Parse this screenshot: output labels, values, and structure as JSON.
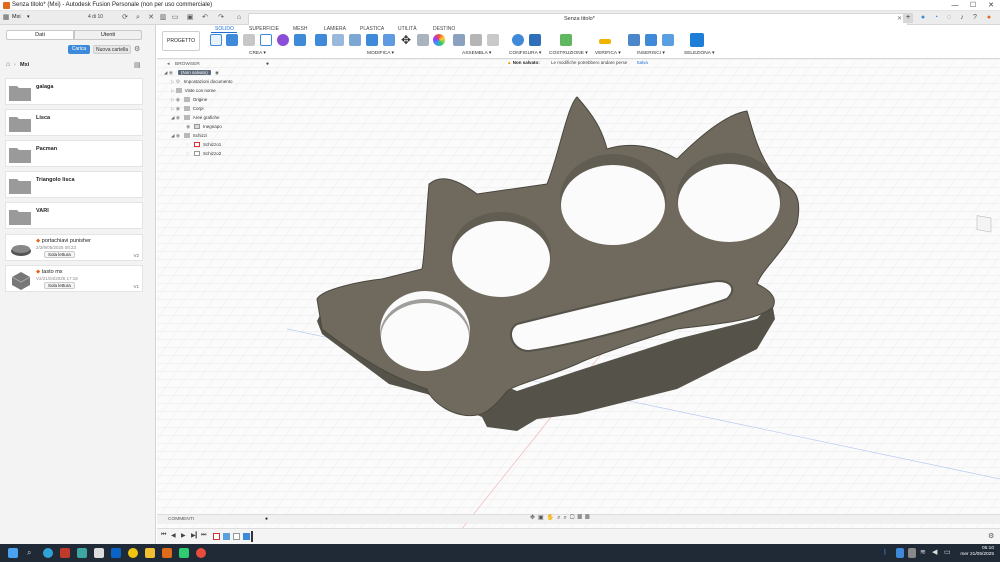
{
  "titlebar": {
    "title": "Senza titolo* (Mxi) - Autodesk Fusion Personale (non per uso commerciale)",
    "minimize": "—",
    "maximize": "☐",
    "close": "✕"
  },
  "appbar": {
    "user": "Mxi",
    "version_badge": "4 di 10",
    "doc_tab": "Senza titolo*"
  },
  "left_panel": {
    "tabs": [
      "Dati",
      "Utenti"
    ],
    "upload_label": "Carica",
    "new_folder_label": "Nuova cartella",
    "breadcrumb": "Mxi",
    "folders": [
      "galaga",
      "Lisca",
      "Pacman",
      "Triangolo lisca",
      "VARI"
    ],
    "designs": [
      {
        "name": "portachiavi punisher",
        "date": "2/3/9/05/2025 08:23",
        "badge": "Sola lettura",
        "version": "V2"
      },
      {
        "name": "tasto mx",
        "date": "V2/21/04/2025 17:18",
        "badge": "Sola lettura",
        "version": "V1"
      }
    ]
  },
  "toolbar": {
    "tabs": [
      "SOLIDO",
      "SUPERFICIE",
      "MESH",
      "LAMIERA",
      "PLASTICA",
      "UTILITÀ",
      "DESTINO"
    ],
    "active_tab": "SOLIDO",
    "project_label": "PROGETTO",
    "groups": [
      "CREA ▾",
      "MODIFICA ▾",
      "ASSEMBLA ▾",
      "CONFIGURA ▾",
      "COSTRUZIONE ▾",
      "VERIFICA ▾",
      "INSERISCI ▾",
      "SELEZIONA ▾"
    ]
  },
  "browser": {
    "title": "BROWSER",
    "root": "(Non salvato)",
    "items": [
      "Impostazioni documento",
      "Viste con nome",
      "Origine",
      "Corpi",
      "Aree grafiche",
      "Inegnapo",
      "Schizzi",
      "Schizzo1",
      "Schizzo2"
    ]
  },
  "status": {
    "unsaved": "Non salvato:",
    "message": "Le modifiche potrebbero andare perse",
    "save": "Salva"
  },
  "comments": {
    "label": "COMMENTI"
  },
  "clock": {
    "time": "05:10",
    "date": "mer 21/05/2025"
  },
  "colors": {
    "accent": "#3f8ad8",
    "part": "#6f6a5d",
    "part_side": "#55524a",
    "taskbar": "#1f2a36"
  }
}
